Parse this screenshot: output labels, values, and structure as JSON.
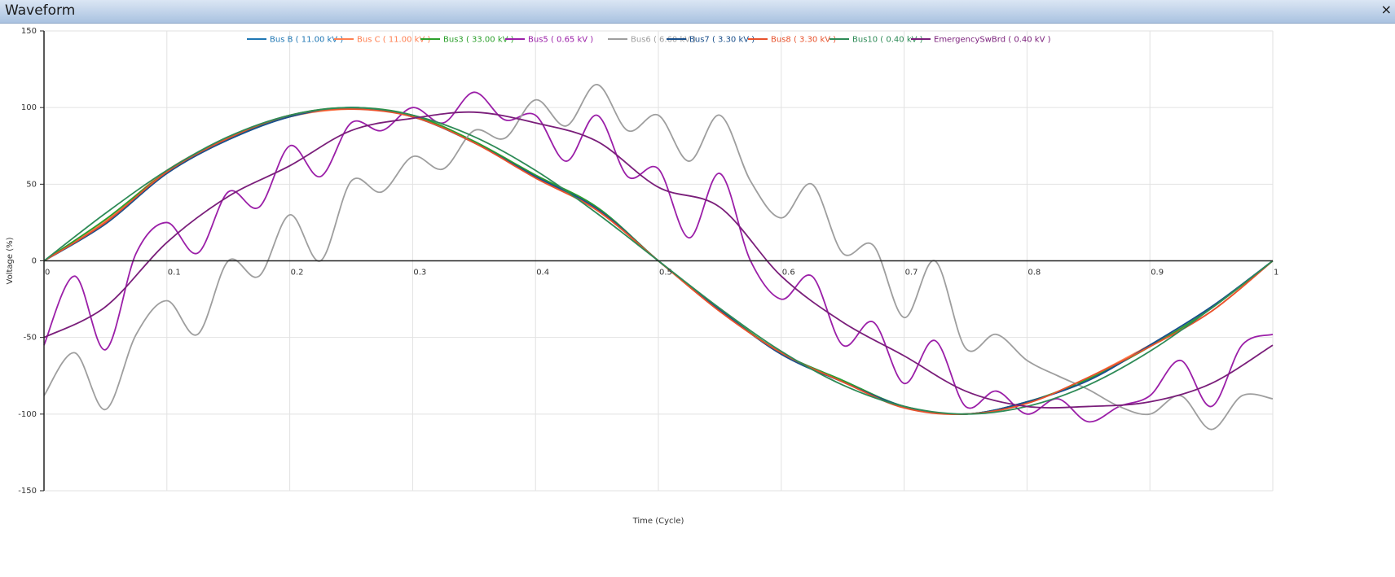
{
  "window": {
    "title": "Waveform",
    "close_label": "×"
  },
  "chart_data": {
    "type": "line",
    "title": "",
    "xlabel": "Time (Cycle)",
    "ylabel": "Voltage (%)",
    "xlim": [
      0,
      1
    ],
    "ylim": [
      -150,
      150
    ],
    "xticks": [
      0,
      0.1,
      0.2,
      0.3,
      0.4,
      0.5,
      0.6,
      0.7,
      0.8,
      0.9,
      1
    ],
    "xtick_labels": [
      "0",
      "0.1",
      "0.2",
      "0.3",
      "0.4",
      "0.5",
      "0.6",
      "0.7",
      "0.8",
      "0.9",
      "1"
    ],
    "yticks": [
      150,
      100,
      50,
      0,
      -50,
      -100,
      -150
    ],
    "ytick_labels": [
      "150",
      "100",
      "50",
      "0",
      "-50",
      "-100",
      "-150"
    ],
    "grid": true,
    "legend_position": "top",
    "series": [
      {
        "name": "Bus B ( 11.00 kV )",
        "color": "#1f77b4",
        "x": [
          0,
          0.05,
          0.1,
          0.15,
          0.2,
          0.25,
          0.3,
          0.35,
          0.4,
          0.45,
          0.5,
          0.55,
          0.6,
          0.65,
          0.7,
          0.75,
          0.8,
          0.85,
          0.9,
          0.95,
          1
        ],
        "y": [
          0,
          25,
          58,
          79,
          94,
          100,
          94,
          78,
          55,
          35,
          0,
          -32,
          -60,
          -78,
          -95,
          -100,
          -92,
          -78,
          -55,
          -30,
          0
        ]
      },
      {
        "name": "Bus C ( 11.00 kV )",
        "color": "#ff7f50",
        "x": [
          0,
          0.05,
          0.1,
          0.15,
          0.2,
          0.25,
          0.3,
          0.35,
          0.4,
          0.45,
          0.5,
          0.55,
          0.6,
          0.65,
          0.7,
          0.75,
          0.8,
          0.85,
          0.9,
          0.95,
          1
        ],
        "y": [
          0,
          26,
          59,
          80,
          94,
          99,
          95,
          77,
          55,
          33,
          0,
          -33,
          -60,
          -79,
          -95,
          -100,
          -93,
          -76,
          -55,
          -33,
          0
        ]
      },
      {
        "name": "Bus3 ( 33.00 kV )",
        "color": "#2ca02c",
        "x": [
          0,
          0.05,
          0.1,
          0.15,
          0.2,
          0.25,
          0.3,
          0.35,
          0.4,
          0.45,
          0.5,
          0.55,
          0.6,
          0.65,
          0.7,
          0.75,
          0.8,
          0.85,
          0.9,
          0.95,
          1
        ],
        "y": [
          0,
          27,
          58,
          80,
          95,
          100,
          95,
          78,
          56,
          35,
          0,
          -32,
          -60,
          -78,
          -95,
          -100,
          -92,
          -77,
          -56,
          -31,
          0
        ]
      },
      {
        "name": "Bus5 ( 0.65 kV )",
        "color": "#9b1fa8",
        "x": [
          0,
          0.025,
          0.05,
          0.075,
          0.1,
          0.125,
          0.15,
          0.175,
          0.2,
          0.225,
          0.25,
          0.275,
          0.3,
          0.325,
          0.35,
          0.375,
          0.4,
          0.425,
          0.45,
          0.475,
          0.5,
          0.525,
          0.55,
          0.575,
          0.6,
          0.625,
          0.65,
          0.675,
          0.7,
          0.725,
          0.75,
          0.775,
          0.8,
          0.825,
          0.85,
          0.875,
          0.9,
          0.925,
          0.95,
          0.975,
          1
        ],
        "y": [
          -55,
          -10,
          -58,
          5,
          25,
          5,
          45,
          35,
          75,
          55,
          90,
          85,
          100,
          90,
          110,
          92,
          95,
          65,
          95,
          55,
          60,
          15,
          57,
          0,
          -25,
          -10,
          -55,
          -40,
          -80,
          -52,
          -95,
          -85,
          -100,
          -90,
          -105,
          -95,
          -88,
          -65,
          -95,
          -55,
          -48
        ]
      },
      {
        "name": "Bus6 ( 6.60 kV )",
        "color": "#9e9e9e",
        "x": [
          0,
          0.025,
          0.05,
          0.075,
          0.1,
          0.125,
          0.15,
          0.175,
          0.2,
          0.225,
          0.25,
          0.275,
          0.3,
          0.325,
          0.35,
          0.375,
          0.4,
          0.425,
          0.45,
          0.475,
          0.5,
          0.525,
          0.55,
          0.575,
          0.6,
          0.625,
          0.65,
          0.675,
          0.7,
          0.725,
          0.75,
          0.775,
          0.8,
          0.825,
          0.85,
          0.875,
          0.9,
          0.925,
          0.95,
          0.975,
          1
        ],
        "y": [
          -88,
          -60,
          -97,
          -48,
          -26,
          -48,
          0,
          -10,
          30,
          0,
          52,
          45,
          68,
          60,
          85,
          80,
          105,
          88,
          115,
          85,
          95,
          65,
          95,
          52,
          28,
          50,
          5,
          10,
          -37,
          0,
          -57,
          -48,
          -65,
          -75,
          -84,
          -95,
          -100,
          -88,
          -110,
          -88,
          -90
        ]
      },
      {
        "name": "Bus7 ( 3.30 kV )",
        "color": "#1a4f8b",
        "x": [
          0,
          0.05,
          0.1,
          0.15,
          0.2,
          0.25,
          0.3,
          0.35,
          0.4,
          0.45,
          0.5,
          0.55,
          0.6,
          0.65,
          0.7,
          0.75,
          0.8,
          0.85,
          0.9,
          0.95,
          1
        ],
        "y": [
          0,
          24,
          57,
          79,
          94,
          100,
          94,
          77,
          55,
          34,
          0,
          -32,
          -61,
          -79,
          -95,
          -100,
          -92,
          -78,
          -55,
          -30,
          0
        ]
      },
      {
        "name": "Bus8 ( 3.30 kV )",
        "color": "#e8522c",
        "x": [
          0,
          0.05,
          0.1,
          0.15,
          0.2,
          0.25,
          0.3,
          0.35,
          0.4,
          0.45,
          0.5,
          0.55,
          0.6,
          0.65,
          0.7,
          0.75,
          0.8,
          0.85,
          0.9,
          0.95,
          1
        ],
        "y": [
          0,
          25,
          58,
          80,
          95,
          99,
          94,
          77,
          54,
          33,
          0,
          -33,
          -60,
          -79,
          -96,
          -100,
          -93,
          -76,
          -56,
          -33,
          0
        ]
      },
      {
        "name": "Bus10 ( 0.40 kV )",
        "color": "#2e8b57",
        "x": [
          0,
          0.05,
          0.1,
          0.15,
          0.2,
          0.25,
          0.3,
          0.35,
          0.4,
          0.45,
          0.5,
          0.55,
          0.6,
          0.65,
          0.7,
          0.75,
          0.8,
          0.85,
          0.9,
          0.95,
          1
        ],
        "y": [
          0,
          31,
          59,
          81,
          95,
          100,
          95,
          81,
          59,
          31,
          0,
          -31,
          -59,
          -81,
          -95,
          -100,
          -95,
          -81,
          -59,
          -31,
          0
        ]
      },
      {
        "name": "EmergencySwBrd ( 0.40 kV )",
        "color": "#7a1e7a",
        "x": [
          0,
          0.05,
          0.1,
          0.15,
          0.2,
          0.25,
          0.3,
          0.35,
          0.4,
          0.45,
          0.5,
          0.55,
          0.6,
          0.65,
          0.7,
          0.75,
          0.8,
          0.85,
          0.9,
          0.95,
          1
        ],
        "y": [
          -50,
          -30,
          12,
          42,
          62,
          85,
          93,
          97,
          90,
          78,
          48,
          35,
          -10,
          -40,
          -62,
          -85,
          -95,
          -95,
          -92,
          -80,
          -55
        ]
      }
    ]
  }
}
